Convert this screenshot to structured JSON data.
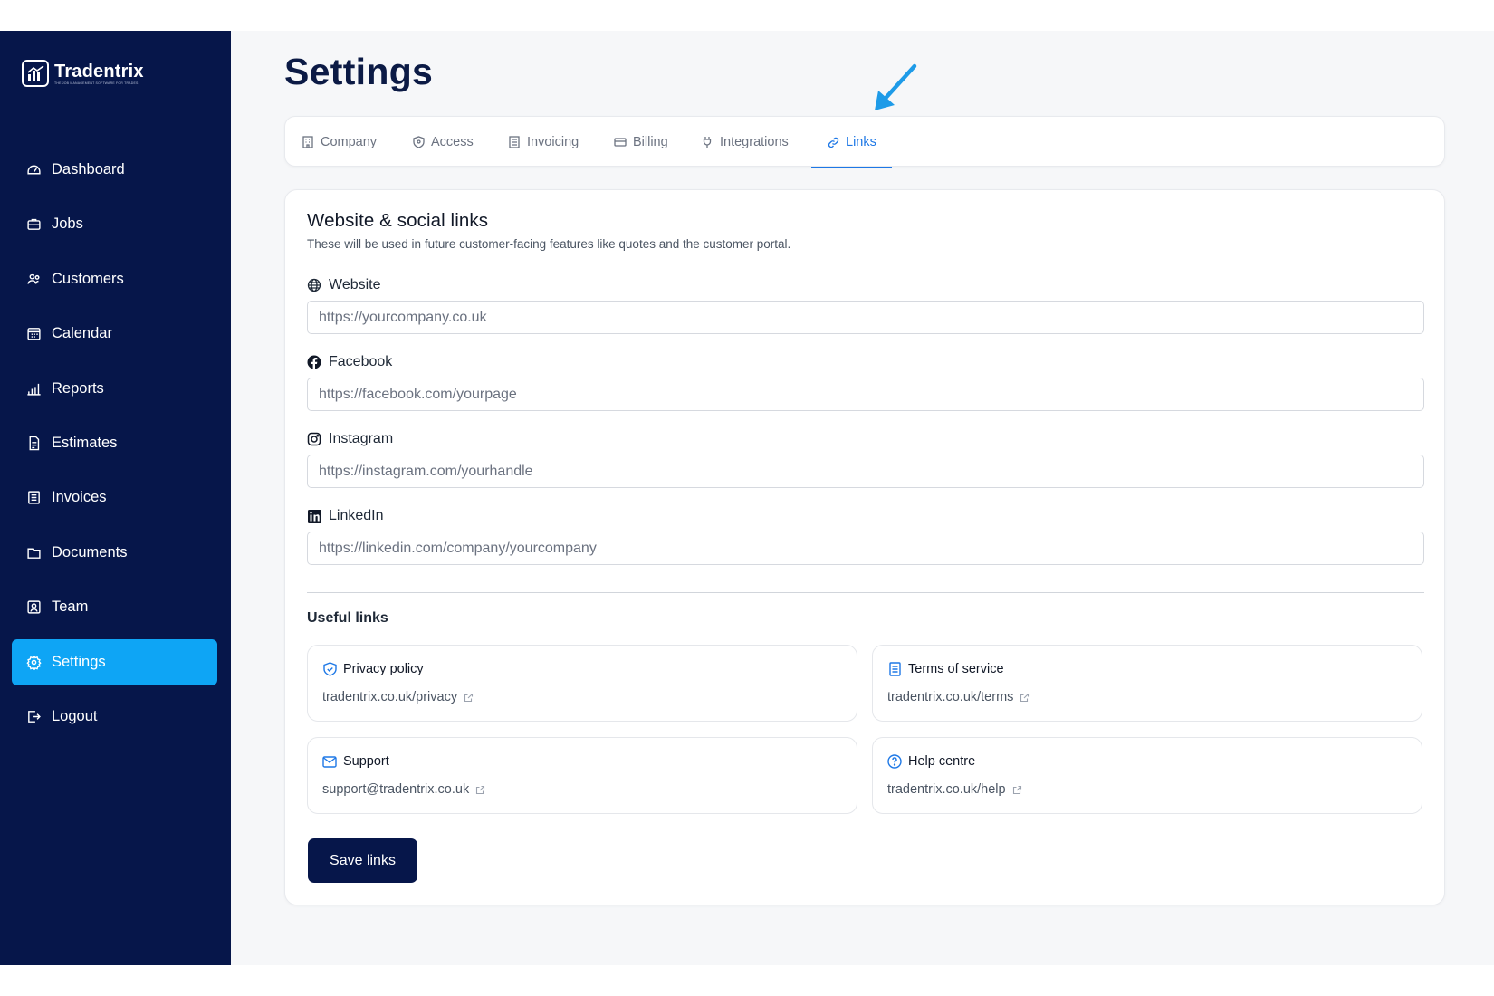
{
  "brand": {
    "name": "Tradentrix",
    "tagline": "THE JOB MANAGEMENT SOFTWARE FOR TRADES"
  },
  "sidebar": {
    "items": [
      {
        "label": "Dashboard",
        "icon": "dashboard-icon"
      },
      {
        "label": "Jobs",
        "icon": "briefcase-icon"
      },
      {
        "label": "Customers",
        "icon": "users-icon"
      },
      {
        "label": "Calendar",
        "icon": "calendar-icon"
      },
      {
        "label": "Reports",
        "icon": "bar-chart-icon"
      },
      {
        "label": "Estimates",
        "icon": "document-icon"
      },
      {
        "label": "Invoices",
        "icon": "invoice-icon"
      },
      {
        "label": "Documents",
        "icon": "folder-icon"
      },
      {
        "label": "Team",
        "icon": "team-icon"
      },
      {
        "label": "Settings",
        "icon": "gear-icon",
        "active": true
      },
      {
        "label": "Logout",
        "icon": "logout-icon"
      }
    ]
  },
  "page": {
    "title": "Settings"
  },
  "tabs": [
    {
      "label": "Company",
      "icon": "building-icon"
    },
    {
      "label": "Access",
      "icon": "shield-icon"
    },
    {
      "label": "Invoicing",
      "icon": "receipt-icon"
    },
    {
      "label": "Billing",
      "icon": "credit-card-icon"
    },
    {
      "label": "Integrations",
      "icon": "plug-icon"
    },
    {
      "label": "Links",
      "icon": "link-icon",
      "active": true
    }
  ],
  "links_section": {
    "title": "Website & social links",
    "subtitle": "These will be used in future customer-facing features like quotes and the customer portal.",
    "fields": [
      {
        "label": "Website",
        "icon": "globe-icon",
        "value": "",
        "placeholder": "https://yourcompany.co.uk"
      },
      {
        "label": "Facebook",
        "icon": "facebook-icon",
        "value": "",
        "placeholder": "https://facebook.com/yourpage"
      },
      {
        "label": "Instagram",
        "icon": "instagram-icon",
        "value": "",
        "placeholder": "https://instagram.com/yourhandle"
      },
      {
        "label": "LinkedIn",
        "icon": "linkedin-icon",
        "value": "",
        "placeholder": "https://linkedin.com/company/yourcompany"
      }
    ]
  },
  "useful_links": {
    "title": "Useful links",
    "items": [
      {
        "title": "Privacy policy",
        "icon": "shield-check-icon",
        "url": "tradentrix.co.uk/privacy"
      },
      {
        "title": "Terms of service",
        "icon": "document-icon",
        "url": "tradentrix.co.uk/terms"
      },
      {
        "title": "Support",
        "icon": "mail-icon",
        "url": "support@tradentrix.co.uk"
      },
      {
        "title": "Help centre",
        "icon": "help-circle-icon",
        "url": "tradentrix.co.uk/help"
      }
    ]
  },
  "actions": {
    "save_label": "Save links"
  },
  "colors": {
    "sidebar_bg": "#06164a",
    "accent": "#0ea5f5",
    "tab_active": "#1e78e6",
    "button_bg": "#06164a"
  }
}
